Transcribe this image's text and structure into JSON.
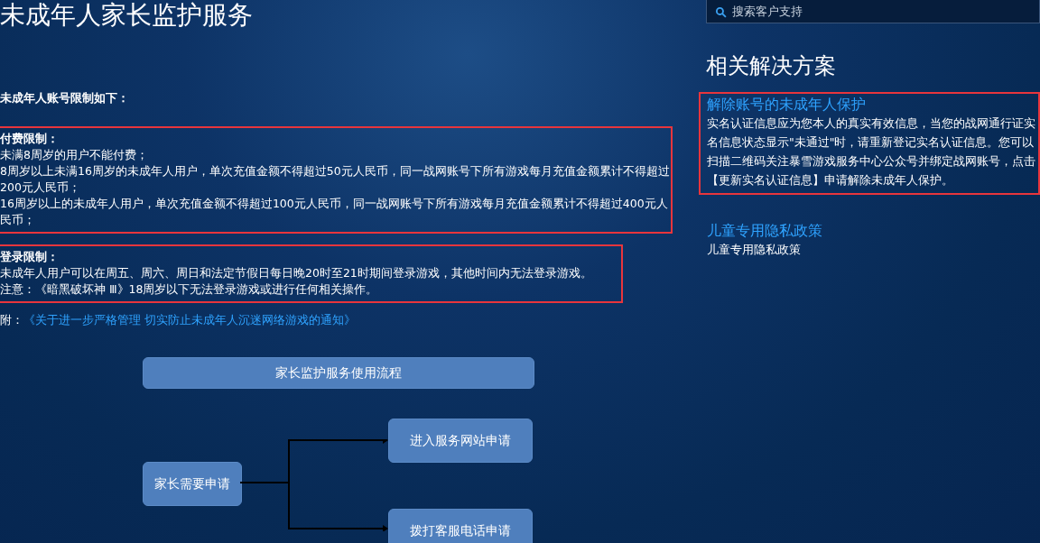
{
  "page_title": "未成年人家长监护服务",
  "search": {
    "placeholder": "搜索客户支持"
  },
  "intro": "未成年人账号限制如下：",
  "sections": [
    {
      "heading": "付费限制：",
      "highlighted": true,
      "lines": [
        "未满8周岁的用户不能付费；",
        "8周岁以上未满16周岁的未成年人用户，单次充值金额不得超过50元人民币，同一战网账号下所有游戏每月充值金额累计不得超过200元人民币；",
        "16周岁以上的未成年人用户，单次充值金额不得超过100元人民币，同一战网账号下所有游戏每月充值金额累计不得超过400元人民币；"
      ]
    },
    {
      "heading": "登录限制：",
      "highlighted": true,
      "lines": [
        "未成年人用户可以在周五、周六、周日和法定节假日每日晚20时至21时期间登录游戏，其他时间内无法登录游戏。",
        "注意：《暗黑破坏神 Ⅲ》18周岁以下无法登录游戏或进行任何相关操作。"
      ]
    }
  ],
  "appendix": {
    "label": "附：",
    "link": "《关于进一步严格管理 切实防止未成年人沉迷网络游戏的通知》"
  },
  "flowchart": {
    "title": "家长监护服务使用流程",
    "start": "家长需要申请",
    "options": [
      "进入服务网站申请",
      "拨打客服电话申请"
    ]
  },
  "sidebar": {
    "heading": "相关解决方案",
    "items": [
      {
        "title": "解除账号的未成年人保护",
        "highlighted": true,
        "description": "实名认证信息应为您本人的真实有效信息，当您的战网通行证实名信息状态显示\"未通过\"时，请重新登记实名认证信息。您可以扫描二维码关注暴雪游戏服务中心公众号并绑定战网账号，点击【更新实名认证信息】申请解除未成年人保护。"
      },
      {
        "title": "儿童专用隐私政策",
        "highlighted": false,
        "description": "儿童专用隐私政策"
      }
    ]
  }
}
